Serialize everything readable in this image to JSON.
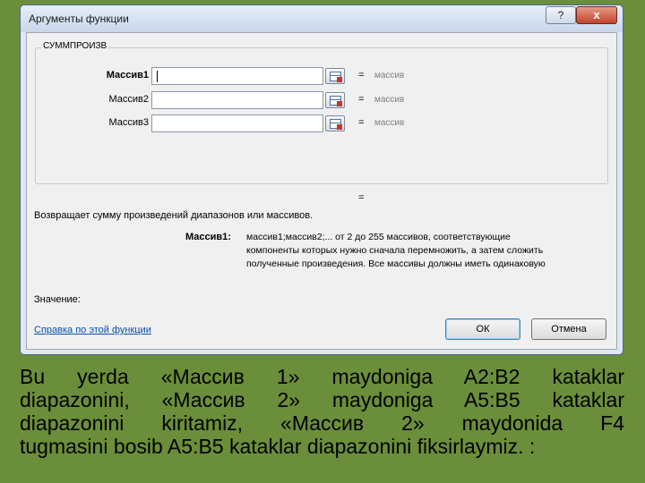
{
  "dialog": {
    "title": "Аргументы функции",
    "help_button": "?",
    "close_button": "x",
    "function_name": "СУММПРОИЗВ",
    "arguments": [
      {
        "label": "Массив1",
        "value": "",
        "equals": "=",
        "hint": "массив"
      },
      {
        "label": "Массив2",
        "value": "",
        "equals": "=",
        "hint": "массив"
      },
      {
        "label": "Массив3",
        "value": "",
        "equals": "=",
        "hint": "массив"
      }
    ],
    "result_equals": "=",
    "description": "Возвращает сумму произведений диапазонов или массивов.",
    "arg_description": {
      "label": "Массив1:",
      "lines": [
        "массив1;массив2;... от 2 до 255 массивов, соответствующие",
        "компоненты которых нужно сначала перемножить, а затем сложить",
        "полученные произведения. Все массивы должны иметь одинаковую"
      ]
    },
    "value_label": "Значение:",
    "help_link": "Справка по этой функции",
    "ok_label": "ОК",
    "cancel_label": "Отмена"
  },
  "caption": {
    "lines": [
      "Bu yerda «Массив 1» maydoniga A2:B2 kataklar",
      "diapazonini, «Массив 2» maydoniga A5:B5 kataklar",
      "diapazonini kiritamiz, «Массив 2» maydonida F4",
      "tugmasini bosib A5:B5 kataklar diapazonini fiksirlaymiz. :"
    ]
  },
  "colors": {
    "background": "#6b8e3a",
    "dialog_bg": "#f0f0f0",
    "link": "#0a4fa8",
    "hint": "#808080"
  }
}
